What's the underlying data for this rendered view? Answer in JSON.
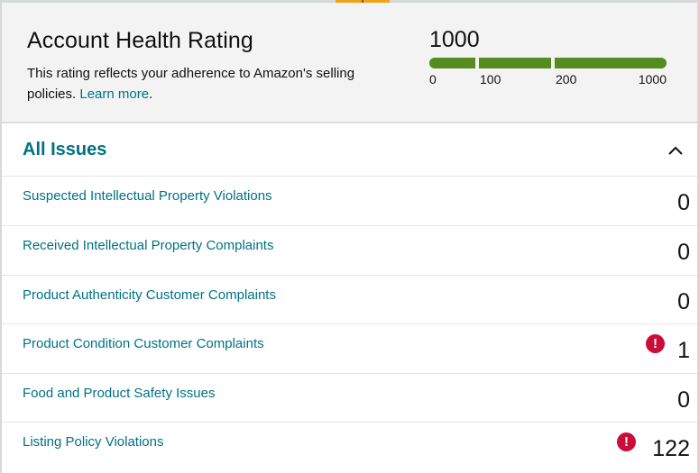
{
  "colors": {
    "link": "#007185",
    "meter_green": "#558b1f",
    "alert_red": "#cc0c39",
    "tab_orange": "#f0a21d",
    "header_bg": "#f3f3f3"
  },
  "header": {
    "title": "Account Health Rating",
    "description": "This rating reflects your adherence to Amazon's selling policies.",
    "learn_more": "Learn more",
    "period": ".",
    "score": "1000",
    "meter": {
      "value": 1000,
      "max": 1000,
      "ticks": [
        "0",
        "100",
        "200",
        "1000"
      ]
    }
  },
  "issues": {
    "title": "All Issues",
    "collapse_icon": "chevron-up-icon",
    "rows": [
      {
        "label": "Suspected Intellectual Property Violations",
        "count": "0",
        "alert": false
      },
      {
        "label": "Received Intellectual Property Complaints",
        "count": "0",
        "alert": false
      },
      {
        "label": "Product Authenticity Customer Complaints",
        "count": "0",
        "alert": false
      },
      {
        "label": "Product Condition Customer Complaints",
        "count": "1",
        "alert": true,
        "alert_icon": "exclamation-icon",
        "alert_glyph": "!"
      },
      {
        "label": "Food and Product Safety Issues",
        "count": "0",
        "alert": false
      },
      {
        "label": "Listing Policy Violations",
        "count": "122",
        "alert": true,
        "alert_icon": "exclamation-icon",
        "alert_glyph": "!"
      }
    ]
  }
}
